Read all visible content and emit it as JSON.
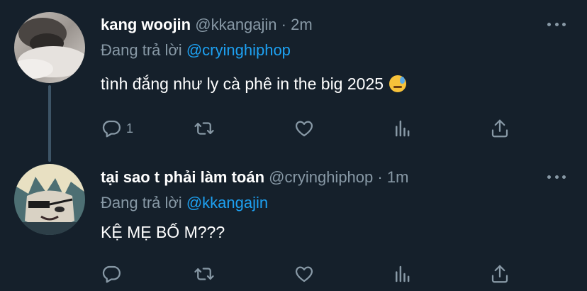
{
  "tweets": [
    {
      "name": "kang woojin",
      "handle": "@kkangajin",
      "separator": "·",
      "time": "2m",
      "reply_prefix": "Đang trả lời",
      "reply_to": "@cryinghiphop",
      "text": "tình đắng như ly cà phê in the big 2025",
      "emoji": "downcast-face-with-sweat",
      "reply_count": "1"
    },
    {
      "name": "tại sao t phải làm toán",
      "handle": "@cryinghiphop",
      "separator": "·",
      "time": "1m",
      "reply_prefix": "Đang trả lời",
      "reply_to": "@kkangajin",
      "text": "KỆ MẸ BỐ M???",
      "reply_count": ""
    }
  ],
  "icons": {
    "reply": "speech-bubble-icon",
    "retweet": "retweet-icon",
    "like": "heart-icon",
    "stats": "bar-chart-icon",
    "share": "share-icon",
    "more": "more-dots-icon"
  },
  "colors": {
    "background": "#15202b",
    "secondary_text": "#8899a6",
    "link": "#1da1f2",
    "thread_line": "#3d5466"
  }
}
